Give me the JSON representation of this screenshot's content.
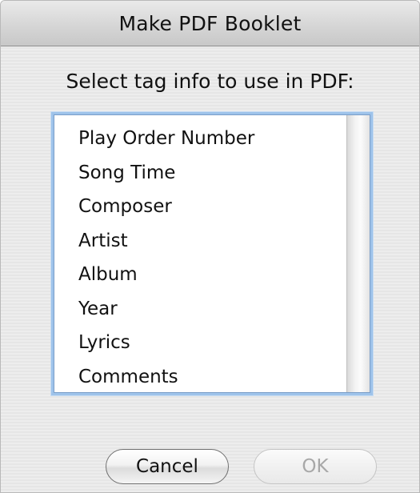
{
  "window": {
    "title": "Make PDF Booklet"
  },
  "prompt": "Select tag info to use in PDF:",
  "list": {
    "items": [
      {
        "label": "Play Order Number"
      },
      {
        "label": "Song Time"
      },
      {
        "label": "Composer"
      },
      {
        "label": "Artist"
      },
      {
        "label": "Album"
      },
      {
        "label": "Year"
      },
      {
        "label": "Lyrics"
      },
      {
        "label": "Comments"
      }
    ]
  },
  "buttons": {
    "cancel_label": "Cancel",
    "ok_label": "OK",
    "ok_enabled": false
  },
  "colors": {
    "focus_ring": "#9ec3ea",
    "disabled_text": "#a8a8a8"
  }
}
